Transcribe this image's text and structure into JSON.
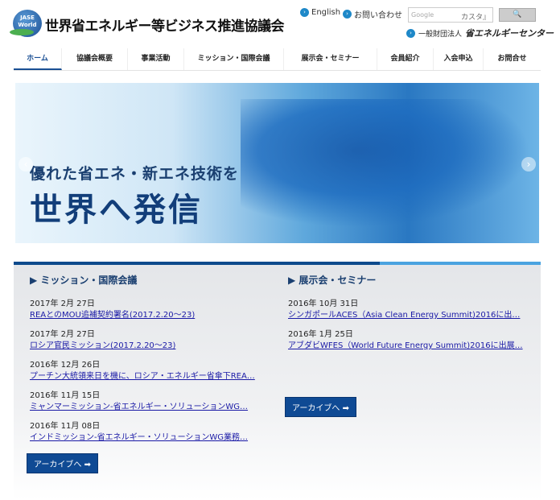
{
  "header": {
    "logo_text": "JASE World",
    "title": "世界省エネルギー等ビジネス推進協議会",
    "english": "English",
    "contact": "お問い合わせ",
    "search_placeholder": "Google",
    "search_custom": "カスタ』",
    "search_button": "🔍",
    "eccj_small": "一般財団法人",
    "eccj_name": "省エネルギーセンター"
  },
  "nav": [
    "ホーム",
    "協議会概要",
    "事業活動",
    "ミッション・国際会議",
    "展示会・セミナー",
    "会員紹介",
    "入会申込",
    "お問合せ"
  ],
  "banner": {
    "line1": "優れた省エネ・新エネ技術を",
    "line2": "世界へ発信",
    "prev": "‹",
    "next": "›"
  },
  "missions": {
    "heading": "▶ ミッション・国際会議",
    "items": [
      {
        "date": "2017年 2月 27日",
        "title": "REAとのMOU追補契約署名(2017.2.20～23)"
      },
      {
        "date": "2017年 2月 27日",
        "title": "ロシア官民ミッション(2017.2.20～23)"
      },
      {
        "date": "2016年 12月 26日",
        "title": "プーチン大統領来日を機に、ロシア・エネルギー省傘下REA…"
      },
      {
        "date": "2016年 11月 15日",
        "title": "ミャンマーミッション-省エネルギー・ソリューションWG…"
      },
      {
        "date": "2016年 11月 08日",
        "title": "インドミッション-省エネルギー・ソリューションWG業務…"
      }
    ],
    "archive": "アーカイブへ ➡"
  },
  "exhibitions": {
    "heading": "▶ 展示会・セミナー",
    "items": [
      {
        "date": "2016年 10月 31日",
        "title": "シンガポールACES（Asia Clean Energy Summit)2016に出…"
      },
      {
        "date": "2016年 1月 25日",
        "title": "アブダビWFES（World Future Energy Summit)2016に出展…"
      }
    ],
    "archive": "アーカイブへ ➡"
  }
}
